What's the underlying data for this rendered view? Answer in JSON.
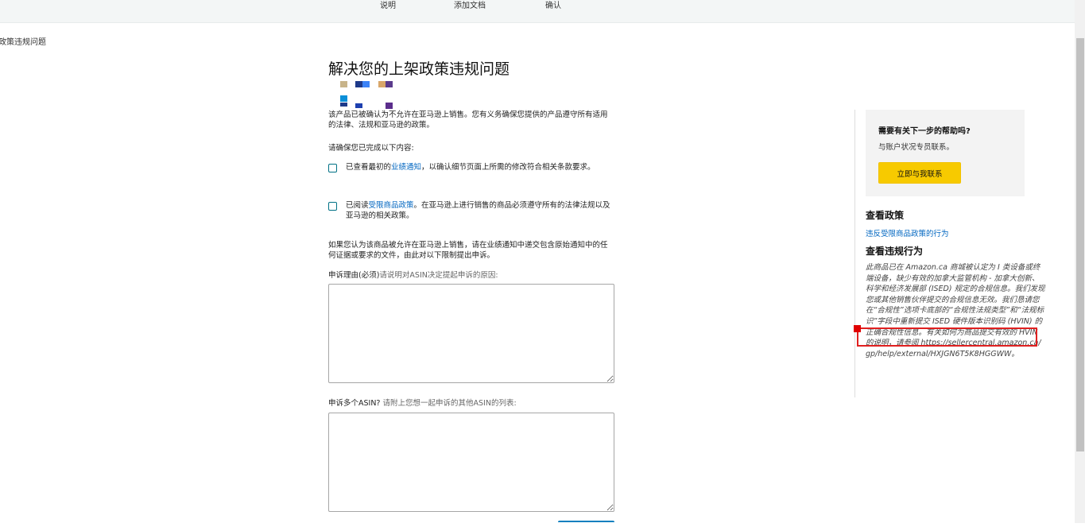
{
  "steps": [
    "说明",
    "添加文档",
    "确认"
  ],
  "breadcrumb": "政策违规问题",
  "main": {
    "title": "解决您的上架政策违规问题",
    "intro": "该产品已被确认为不允许在亚马逊上销售。您有义务确保您提供的产品遵守所有适用的法律、法规和亚马逊的政策。",
    "checklist_heading": "请确保您已完成以下内容:",
    "checklist": [
      {
        "before": "已查看最初的",
        "link": "业绩通知",
        "after": "，以确认细节页面上所需的修改符合相关条款要求。"
      },
      {
        "before": "已阅读",
        "link": "受限商品政策",
        "after": "。在亚马逊上进行销售的商品必须遵守所有的法律法规以及亚马逊的相关政策。"
      }
    ],
    "appeal_intro": "如果您认为该商品被允许在亚马逊上销售，请在业绩通知中递交包含原始通知中的任何证据或要求的文件，由此对以下限制提出申诉。",
    "reason_label": "申诉理由(必须)",
    "reason_hint": "请说明对ASIN决定提起申诉的原因:",
    "reason_value": "",
    "multi_label": "申诉多个ASIN?",
    "multi_hint": "请附上您想一起申诉的其他ASIN的列表:",
    "multi_value": ""
  },
  "sidebar": {
    "help_title": "需要有关下一步的帮助吗?",
    "help_sub": "与账户状况专员联系。",
    "help_button": "立即与我联系",
    "policy_heading": "查看政策",
    "policy_link": "违反受限商品政策的行为",
    "violation_heading": "查看违规行为",
    "violation_text": "此商品已在 Amazon.ca 商城被认定为 I 类设备或终端设备，缺少有效的加拿大监管机构 - 加拿大创新、科学和经济发展部 (ISED) 规定的合规信息。我们发现您或其他销售伙伴提交的合规信息无效。我们恳请您在“合规性”选项卡底部的“合规性法规类型”和“法规标识”字段中重新提交 ISED 硬件版本识别码 (HVIN) 的正确合规性信息。有关如何为商品提交有效的 HVIN 的说明，请参阅 https://sellercentral.amazon.ca/gp/help/external/HXJGN6T5K8HGGWW。"
  },
  "colors": {
    "link": "#0066c0",
    "checkbox": "#007185",
    "button": "#f7ca00",
    "highlight": "#e02020"
  }
}
